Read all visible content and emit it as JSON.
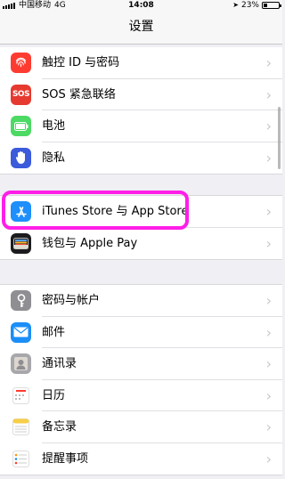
{
  "status_bar": {
    "carrier": "中国移动",
    "network": "4G",
    "time": "14:08",
    "battery": "23%",
    "battery_level": 0.23
  },
  "nav": {
    "title": "设置"
  },
  "colors": {
    "highlight": "#ff1ee8"
  },
  "group1": [
    {
      "label": "触控 ID 与密码",
      "icon": "fingerprint-icon",
      "color": "#fe3b30"
    },
    {
      "label": "SOS 紧急联络",
      "icon": "sos-icon",
      "icon_text": "SOS",
      "color": "#e63a30"
    },
    {
      "label": "电池",
      "icon": "battery-icon",
      "color": "#4cd964"
    },
    {
      "label": "隐私",
      "icon": "hand-icon",
      "color": "#3b5bdb"
    }
  ],
  "group2": [
    {
      "label": "iTunes Store 与 App Store",
      "icon": "app-store-icon",
      "color": "#1e8ffb"
    },
    {
      "label": "钱包与 Apple Pay",
      "icon": "wallet-icon",
      "color": "#1c1c1e"
    }
  ],
  "group3": [
    {
      "label": "密码与帐户",
      "icon": "key-icon",
      "color": "#8e8e93"
    },
    {
      "label": "邮件",
      "icon": "mail-icon",
      "color": "#1b8ef7"
    },
    {
      "label": "通讯录",
      "icon": "contacts-icon",
      "color": "#a7a7ac"
    },
    {
      "label": "日历",
      "icon": "calendar-icon",
      "color": "#ffffff"
    },
    {
      "label": "备忘录",
      "icon": "notes-icon",
      "color": "#ffffff"
    },
    {
      "label": "提醒事项",
      "icon": "reminders-icon",
      "color": "#ffffff"
    }
  ]
}
